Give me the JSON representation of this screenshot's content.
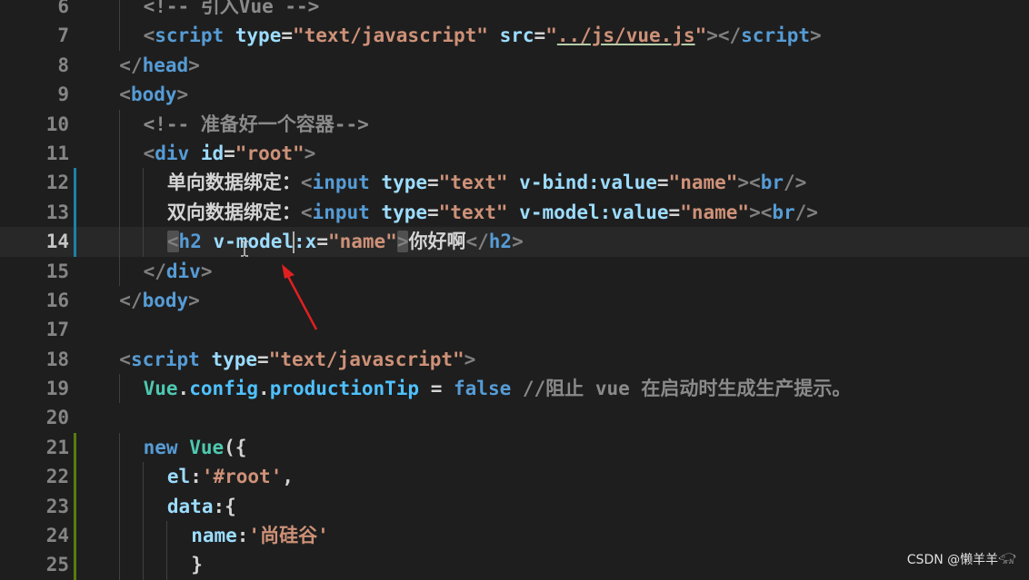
{
  "editor": {
    "current_line": 14,
    "lines": [
      {
        "n": "6",
        "tokens": [
          {
            "c": "cmg",
            "t": "<!-- 引入Vue -->"
          }
        ]
      },
      {
        "n": "7",
        "tokens": [
          {
            "c": "p",
            "t": "<"
          },
          {
            "c": "t",
            "t": "script"
          },
          {
            "c": "tx",
            "t": " "
          },
          {
            "c": "a",
            "t": "type"
          },
          {
            "c": "tx",
            "t": "="
          },
          {
            "c": "s",
            "t": "\"text/javascript\""
          },
          {
            "c": "tx",
            "t": " "
          },
          {
            "c": "a",
            "t": "src"
          },
          {
            "c": "tx",
            "t": "="
          },
          {
            "c": "s",
            "t": "\""
          },
          {
            "c": "s ul",
            "t": "../js/vue.js"
          },
          {
            "c": "s",
            "t": "\""
          },
          {
            "c": "p",
            "t": "></"
          },
          {
            "c": "t",
            "t": "script"
          },
          {
            "c": "p",
            "t": ">"
          }
        ]
      },
      {
        "n": "8",
        "tokens": [
          {
            "c": "p",
            "t": "</"
          },
          {
            "c": "t",
            "t": "head"
          },
          {
            "c": "p",
            "t": ">"
          }
        ]
      },
      {
        "n": "9",
        "tokens": [
          {
            "c": "p",
            "t": "<"
          },
          {
            "c": "t",
            "t": "body"
          },
          {
            "c": "p",
            "t": ">"
          }
        ]
      },
      {
        "n": "10",
        "tokens": [
          {
            "c": "cmg",
            "t": "<!-- 准备好一个容器-->"
          }
        ]
      },
      {
        "n": "11",
        "tokens": [
          {
            "c": "p",
            "t": "<"
          },
          {
            "c": "t",
            "t": "div"
          },
          {
            "c": "tx",
            "t": " "
          },
          {
            "c": "a",
            "t": "id"
          },
          {
            "c": "tx",
            "t": "="
          },
          {
            "c": "s",
            "t": "\"root\""
          },
          {
            "c": "p",
            "t": ">"
          }
        ]
      },
      {
        "n": "12",
        "tokens": [
          {
            "c": "tx",
            "t": "单向数据绑定："
          },
          {
            "c": "p",
            "t": "<"
          },
          {
            "c": "t",
            "t": "input"
          },
          {
            "c": "tx",
            "t": " "
          },
          {
            "c": "a",
            "t": "type"
          },
          {
            "c": "tx",
            "t": "="
          },
          {
            "c": "s",
            "t": "\"text\""
          },
          {
            "c": "tx",
            "t": " "
          },
          {
            "c": "a",
            "t": "v-bind:value"
          },
          {
            "c": "tx",
            "t": "="
          },
          {
            "c": "s",
            "t": "\"name\""
          },
          {
            "c": "p",
            "t": "><"
          },
          {
            "c": "t",
            "t": "br"
          },
          {
            "c": "p",
            "t": "/>"
          }
        ]
      },
      {
        "n": "13",
        "tokens": [
          {
            "c": "tx",
            "t": "双向数据绑定："
          },
          {
            "c": "p",
            "t": "<"
          },
          {
            "c": "t",
            "t": "input"
          },
          {
            "c": "tx",
            "t": " "
          },
          {
            "c": "a",
            "t": "type"
          },
          {
            "c": "tx",
            "t": "="
          },
          {
            "c": "s",
            "t": "\"text\""
          },
          {
            "c": "tx",
            "t": " "
          },
          {
            "c": "a",
            "t": "v-model:value"
          },
          {
            "c": "tx",
            "t": "="
          },
          {
            "c": "s",
            "t": "\"name\""
          },
          {
            "c": "p",
            "t": "><"
          },
          {
            "c": "t",
            "t": "br"
          },
          {
            "c": "p",
            "t": "/>"
          }
        ]
      },
      {
        "n": "14",
        "tokens": [
          {
            "c": "p hl",
            "t": "<"
          },
          {
            "c": "t",
            "t": "h2"
          },
          {
            "c": "tx",
            "t": " "
          },
          {
            "c": "a",
            "t": "v-model"
          },
          {
            "c": "caret",
            "t": ""
          },
          {
            "c": "a",
            "t": ":x"
          },
          {
            "c": "tx",
            "t": "="
          },
          {
            "c": "s",
            "t": "\"name\""
          },
          {
            "c": "p hl",
            "t": ">"
          },
          {
            "c": "tx",
            "t": "你好啊"
          },
          {
            "c": "p",
            "t": "</"
          },
          {
            "c": "t",
            "t": "h2"
          },
          {
            "c": "p",
            "t": ">"
          }
        ]
      },
      {
        "n": "15",
        "tokens": [
          {
            "c": "p",
            "t": "</"
          },
          {
            "c": "t",
            "t": "div"
          },
          {
            "c": "p",
            "t": ">"
          }
        ]
      },
      {
        "n": "16",
        "tokens": [
          {
            "c": "p",
            "t": "</"
          },
          {
            "c": "t",
            "t": "body"
          },
          {
            "c": "p",
            "t": ">"
          }
        ]
      },
      {
        "n": "17",
        "tokens": []
      },
      {
        "n": "18",
        "tokens": [
          {
            "c": "p",
            "t": "<"
          },
          {
            "c": "t",
            "t": "script"
          },
          {
            "c": "tx",
            "t": " "
          },
          {
            "c": "a",
            "t": "type"
          },
          {
            "c": "tx",
            "t": "="
          },
          {
            "c": "s",
            "t": "\"text/javascript\""
          },
          {
            "c": "p",
            "t": ">"
          }
        ]
      },
      {
        "n": "19",
        "tokens": [
          {
            "c": "cls",
            "t": "Vue"
          },
          {
            "c": "tx",
            "t": "."
          },
          {
            "c": "v",
            "t": "config"
          },
          {
            "c": "tx",
            "t": "."
          },
          {
            "c": "v",
            "t": "productionTip"
          },
          {
            "c": "tx",
            "t": " = "
          },
          {
            "c": "kw",
            "t": "false"
          },
          {
            "c": "tx",
            "t": " "
          },
          {
            "c": "cmg",
            "t": "//阻止 vue 在启动时生成生产提示。"
          }
        ]
      },
      {
        "n": "20",
        "tokens": []
      },
      {
        "n": "21",
        "tokens": [
          {
            "c": "kw",
            "t": "new"
          },
          {
            "c": "tx",
            "t": " "
          },
          {
            "c": "cls",
            "t": "Vue"
          },
          {
            "c": "tx",
            "t": "({"
          }
        ]
      },
      {
        "n": "22",
        "tokens": [
          {
            "c": "a",
            "t": "el"
          },
          {
            "c": "tx",
            "t": ":"
          },
          {
            "c": "s",
            "t": "'#root'"
          },
          {
            "c": "tx",
            "t": ","
          }
        ]
      },
      {
        "n": "23",
        "tokens": [
          {
            "c": "a",
            "t": "data"
          },
          {
            "c": "tx",
            "t": ":{"
          }
        ]
      },
      {
        "n": "24",
        "tokens": [
          {
            "c": "a",
            "t": "name"
          },
          {
            "c": "tx",
            "t": ":"
          },
          {
            "c": "s",
            "t": "'尚硅谷'"
          }
        ]
      },
      {
        "n": "25",
        "tokens": [
          {
            "c": "tx",
            "t": "}"
          }
        ]
      }
    ]
  },
  "watermark": "CSDN @懒羊羊𓃟",
  "colors": {
    "background": "#1e1e1e",
    "tag": "#569cd6",
    "attribute": "#9cdcfe",
    "string": "#ce9178",
    "comment": "#8a8a8a",
    "annotation_arrow": "#e02020"
  }
}
